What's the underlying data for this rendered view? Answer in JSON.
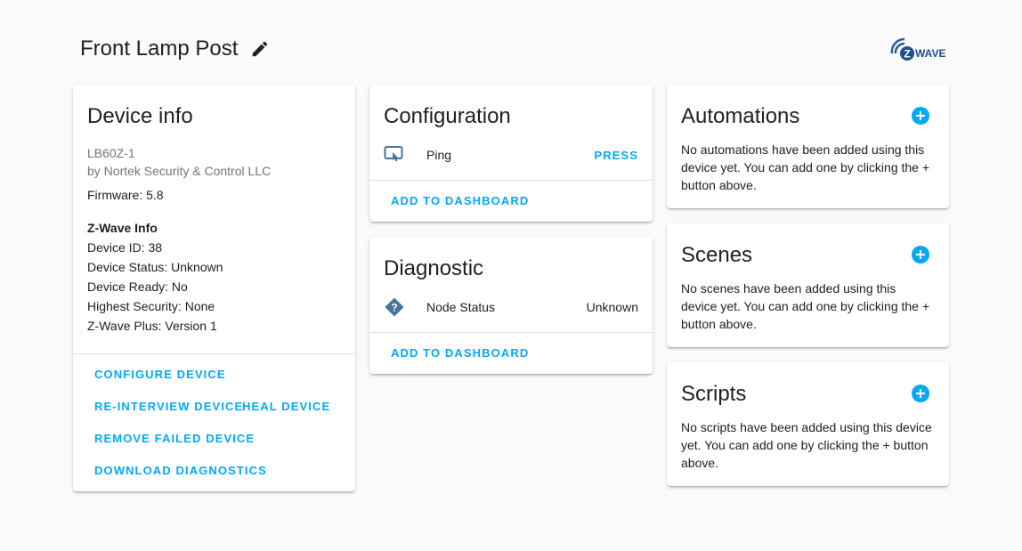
{
  "header": {
    "title": "Front Lamp Post"
  },
  "logo": {
    "text": "WAVE",
    "letter": "Z"
  },
  "device_info": {
    "title": "Device info",
    "model": "LB60Z-1",
    "manufacturer": "by Nortek Security & Control LLC",
    "firmware": "Firmware: 5.8",
    "zwave_heading": "Z-Wave Info",
    "device_id": "Device ID: 38",
    "device_status": "Device Status: Unknown",
    "device_ready": "Device Ready: No",
    "highest_security": "Highest Security: None",
    "zwave_plus": "Z-Wave Plus: Version 1",
    "actions": {
      "configure": "CONFIGURE DEVICE",
      "reinterview": "RE-INTERVIEW DEVICE",
      "heal": "HEAL DEVICE",
      "remove_failed": "REMOVE FAILED DEVICE",
      "download": "DOWNLOAD DIAGNOSTICS"
    }
  },
  "configuration": {
    "title": "Configuration",
    "entity_name": "Ping",
    "entity_action": "PRESS",
    "add_to_dashboard": "ADD TO DASHBOARD"
  },
  "diagnostic": {
    "title": "Diagnostic",
    "entity_name": "Node Status",
    "entity_value": "Unknown",
    "add_to_dashboard": "ADD TO DASHBOARD"
  },
  "automations": {
    "title": "Automations",
    "text": "No automations have been added using this device yet. You can add one by clicking the + button above."
  },
  "scenes": {
    "title": "Scenes",
    "text": "No scenes have been added using this device yet. You can add one by clicking the + button above."
  },
  "scripts": {
    "title": "Scripts",
    "text": "No scripts have been added using this device yet. You can add one by clicking the + button above."
  },
  "colors": {
    "accent": "#03a9f4",
    "icon": "#44739e",
    "text": "#212121",
    "secondary": "#757575"
  }
}
